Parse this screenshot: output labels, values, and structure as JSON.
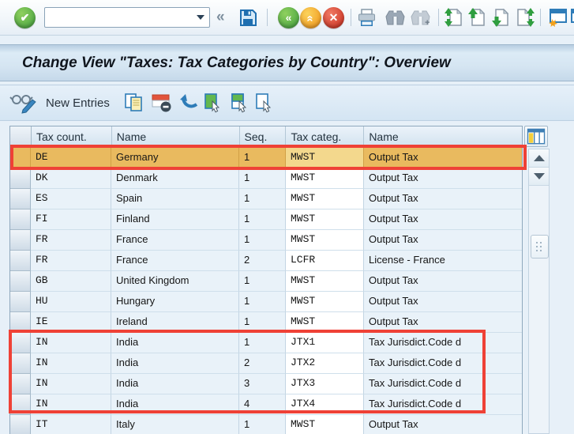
{
  "title_bar": {
    "title": "Change View \"Taxes: Tax Categories by Country\": Overview"
  },
  "top_toolbar": {
    "command_field": {
      "value": ""
    },
    "icons": [
      "enter-check",
      "command-dropdown",
      "collapse-chevrons",
      "save",
      "back",
      "exit",
      "cancel",
      "print",
      "find",
      "find-next",
      "first-page",
      "page-up",
      "page-down",
      "last-page",
      "new-session",
      "clipped-icon"
    ]
  },
  "app_toolbar": {
    "new_entries_label": "New Entries",
    "icons": [
      "display-change-toggle",
      "copy-entries",
      "delete-line",
      "undo",
      "select-all",
      "select-block",
      "deselect-all"
    ]
  },
  "table": {
    "headers": {
      "tax_country": "Tax count.",
      "name": "Name",
      "seq": "Seq.",
      "tax_categ": "Tax categ.",
      "categ_name": "Name"
    },
    "rows": [
      {
        "tax_country": "DE",
        "name": "Germany",
        "seq": "1",
        "tax_categ": "MWST",
        "categ_name": "Output Tax",
        "selected": true
      },
      {
        "tax_country": "DK",
        "name": "Denmark",
        "seq": "1",
        "tax_categ": "MWST",
        "categ_name": "Output Tax"
      },
      {
        "tax_country": "ES",
        "name": "Spain",
        "seq": "1",
        "tax_categ": "MWST",
        "categ_name": "Output Tax"
      },
      {
        "tax_country": "FI",
        "name": "Finland",
        "seq": "1",
        "tax_categ": "MWST",
        "categ_name": "Output Tax"
      },
      {
        "tax_country": "FR",
        "name": "France",
        "seq": "1",
        "tax_categ": "MWST",
        "categ_name": "Output Tax"
      },
      {
        "tax_country": "FR",
        "name": "France",
        "seq": "2",
        "tax_categ": "LCFR",
        "categ_name": "License - France"
      },
      {
        "tax_country": "GB",
        "name": "United Kingdom",
        "seq": "1",
        "tax_categ": "MWST",
        "categ_name": "Output Tax"
      },
      {
        "tax_country": "HU",
        "name": "Hungary",
        "seq": "1",
        "tax_categ": "MWST",
        "categ_name": "Output Tax"
      },
      {
        "tax_country": "IE",
        "name": "Ireland",
        "seq": "1",
        "tax_categ": "MWST",
        "categ_name": "Output Tax"
      },
      {
        "tax_country": "IN",
        "name": "India",
        "seq": "1",
        "tax_categ": "JTX1",
        "categ_name": "Tax Jurisdict.Code d"
      },
      {
        "tax_country": "IN",
        "name": "India",
        "seq": "2",
        "tax_categ": "JTX2",
        "categ_name": "Tax Jurisdict.Code d"
      },
      {
        "tax_country": "IN",
        "name": "India",
        "seq": "3",
        "tax_categ": "JTX3",
        "categ_name": "Tax Jurisdict.Code d"
      },
      {
        "tax_country": "IN",
        "name": "India",
        "seq": "4",
        "tax_categ": "JTX4",
        "categ_name": "Tax Jurisdict.Code d"
      },
      {
        "tax_country": "IT",
        "name": "Italy",
        "seq": "1",
        "tax_categ": "MWST",
        "categ_name": "Output Tax"
      }
    ]
  },
  "annotations": {
    "color": "#ef4136",
    "boxes": [
      "germany-row-highlight",
      "india-rows-highlight"
    ]
  },
  "colors": {
    "selected_row": "#e9ba5f",
    "selected_row_editable_cell": "#f3d88d",
    "row_background": "#e9f2f9",
    "editable_cell_background": "#ffffff",
    "toolbar_enter_green": "#3f9e3e",
    "toolbar_exit_orange": "#ef8f14",
    "toolbar_cancel_red": "#c6281a"
  }
}
